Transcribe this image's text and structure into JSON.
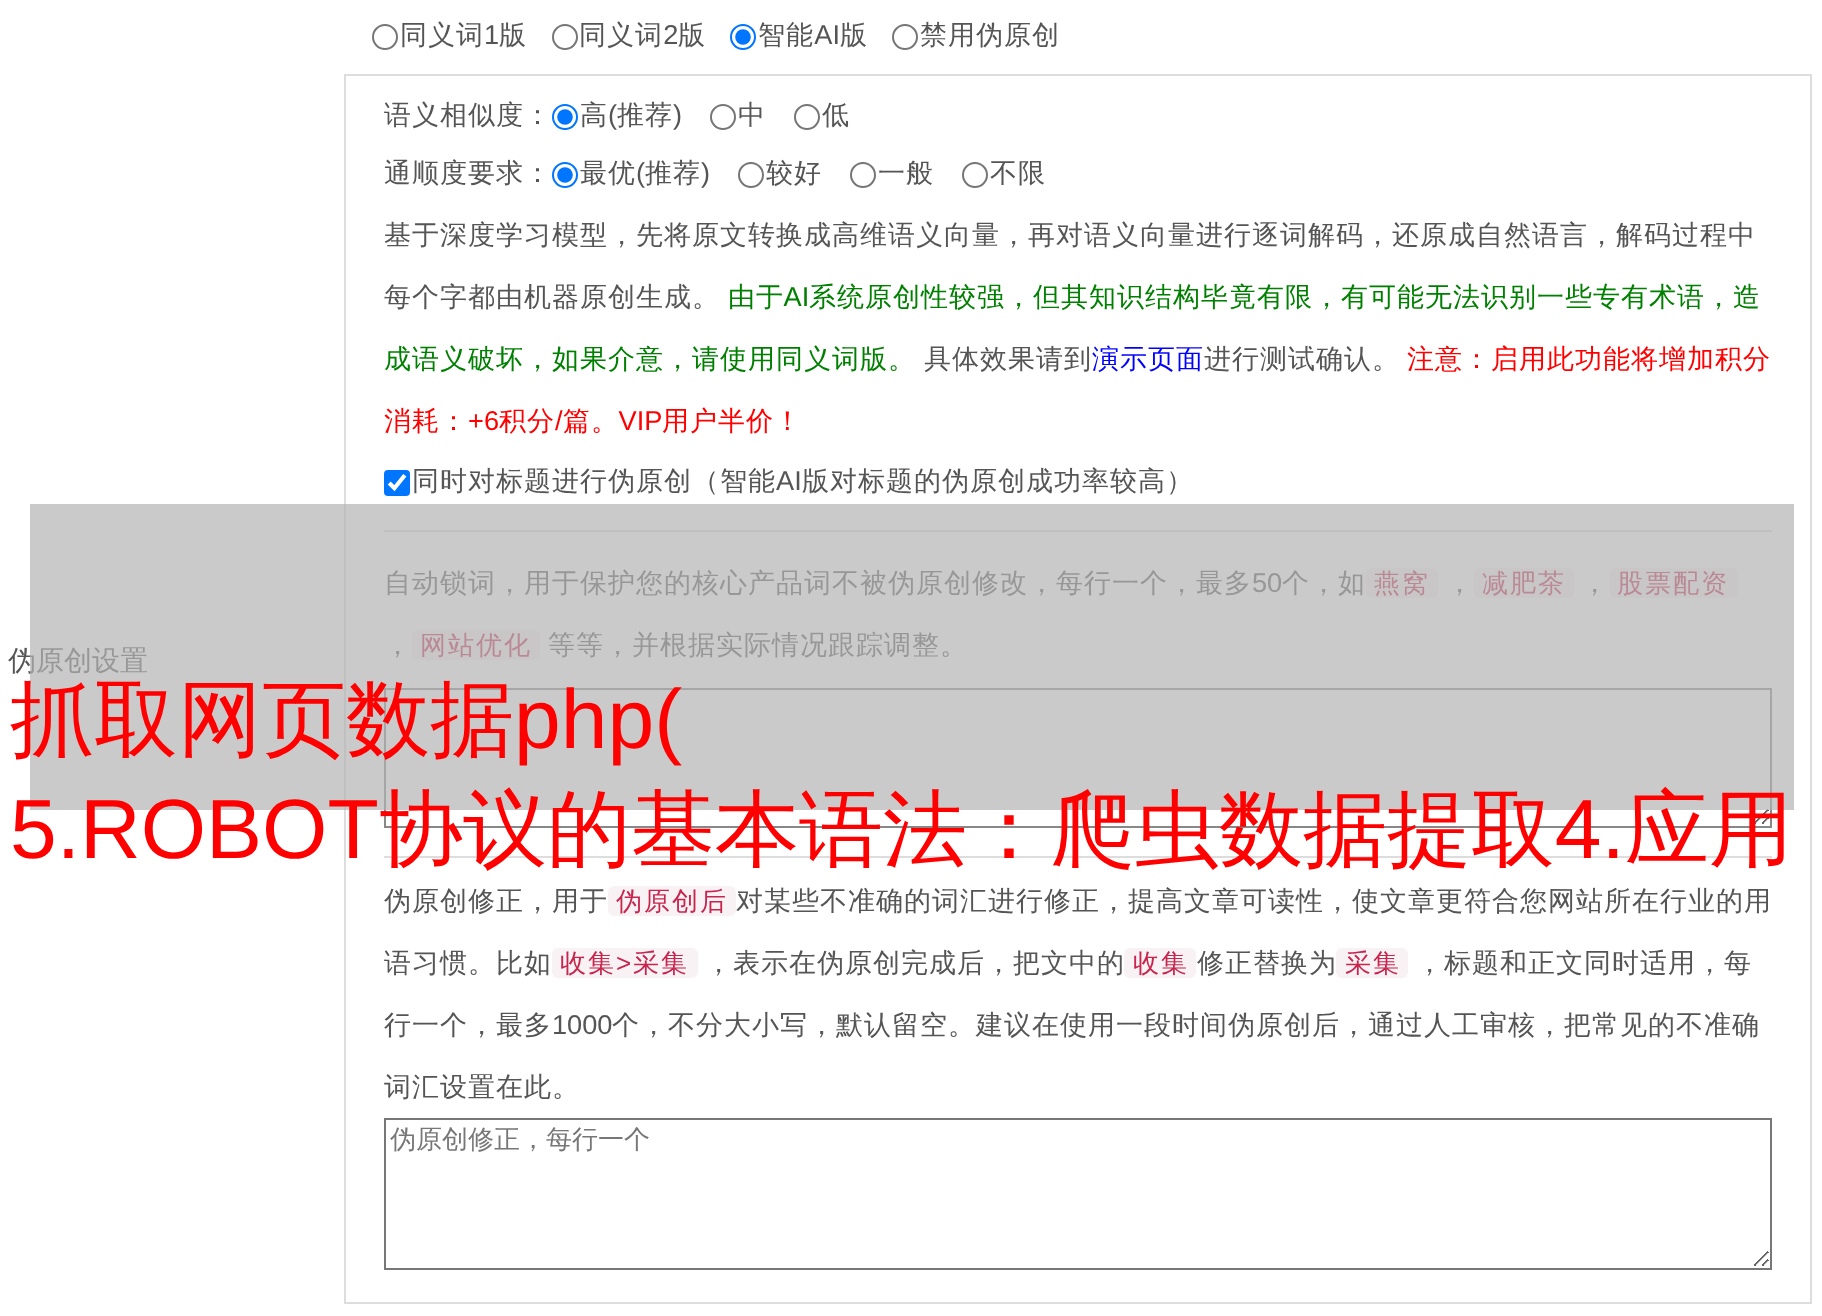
{
  "versions": [
    {
      "label": "同义词1版",
      "selected": false
    },
    {
      "label": "同义词2版",
      "selected": false
    },
    {
      "label": "智能AI版",
      "selected": true
    },
    {
      "label": "禁用伪原创",
      "selected": false
    }
  ],
  "similarity": {
    "label": "语义相似度：",
    "options": [
      {
        "label": "高(推荐)",
        "selected": true
      },
      {
        "label": "中",
        "selected": false
      },
      {
        "label": "低",
        "selected": false
      }
    ]
  },
  "fluency": {
    "label": "通顺度要求：",
    "options": [
      {
        "label": "最优(推荐)",
        "selected": true
      },
      {
        "label": "较好",
        "selected": false
      },
      {
        "label": "一般",
        "selected": false
      },
      {
        "label": "不限",
        "selected": false
      }
    ]
  },
  "ai_description": [
    {
      "kind": "text",
      "text": "基于深度学习模型，先将原文转换成高维语义向量，再对语义向量进行逐词解码，还原成自然语言，解码过程中每个字都由机器原创生成。 "
    },
    {
      "kind": "green",
      "text": "由于AI系统原创性较强，但其知识结构毕竟有限，有可能无法识别一些专有术语，造成语义破坏，如果介意，请使用同义词版。"
    },
    {
      "kind": "text",
      "text": " 具体效果请到"
    },
    {
      "kind": "link",
      "text": "演示页面"
    },
    {
      "kind": "text",
      "text": "进行测试确认。 "
    },
    {
      "kind": "red",
      "text": "注意：启用此功能将增加积分消耗：+6积分/篇。VIP用户半价！"
    }
  ],
  "title_option": {
    "label": "同时对标题进行伪原创（智能AI版对标题的伪原创成功率较高）",
    "checked": true
  },
  "side_label": "伪原创设置",
  "lock_words": {
    "description": [
      {
        "kind": "text",
        "text": "自动锁词，用于保护您的核心产品词不被伪原创修改，每行一个，最多50个，如"
      },
      {
        "kind": "code",
        "text": "燕窝"
      },
      {
        "kind": "text",
        "text": " ，"
      },
      {
        "kind": "code",
        "text": "减肥茶"
      },
      {
        "kind": "text",
        "text": " ，"
      },
      {
        "kind": "code",
        "text": "股票配资"
      },
      {
        "kind": "text",
        "text": " ，"
      },
      {
        "kind": "code",
        "text": "网站优化"
      },
      {
        "kind": "text",
        "text": " 等等，并根据实际情况跟踪调整。"
      }
    ]
  },
  "corrections": {
    "description": [
      {
        "kind": "text",
        "text": "伪原创修正，用于"
      },
      {
        "kind": "code",
        "text": "伪原创后"
      },
      {
        "kind": "text",
        "text": "对某些不准确的词汇进行修正，提高文章可读性，使文章更符合您网站所在行业的用语习惯。比如"
      },
      {
        "kind": "code",
        "text": "收集>采集"
      },
      {
        "kind": "text",
        "text": " ，表示在伪原创完成后，把文中的"
      },
      {
        "kind": "code",
        "text": "收集"
      },
      {
        "kind": "text",
        "text": "修正替换为"
      },
      {
        "kind": "code",
        "text": "采集"
      },
      {
        "kind": "text",
        "text": " ，标题和正文同时适用，每行一个，最多1000个，不分大小写，默认留空。建议在使用一段时间伪原创后，通过人工审核，把常见的不准确词汇设置在此。"
      }
    ],
    "placeholder": "伪原创修正，每行一个"
  },
  "overlay_title": [
    "抓取网页数据php(",
    "5.ROBOT协议的基本语法：爬虫数据提取4.应用"
  ]
}
